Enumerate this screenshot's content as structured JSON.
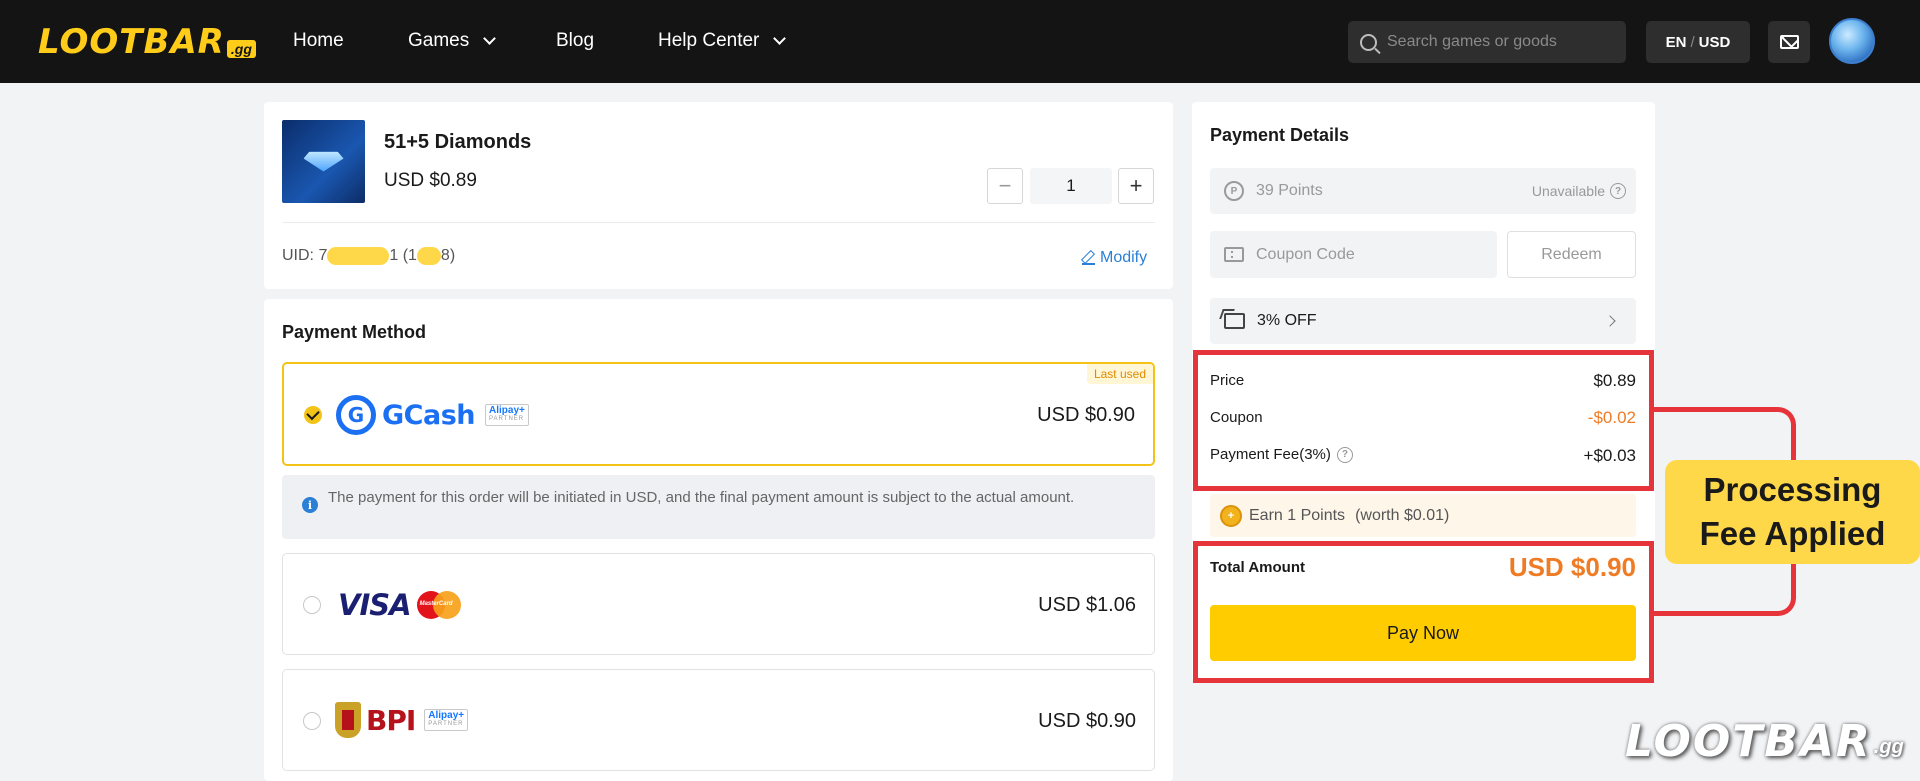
{
  "nav": {
    "logo_text": "LOOTBAR",
    "logo_suffix": ".gg",
    "home": "Home",
    "games": "Games",
    "blog": "Blog",
    "help_center": "Help Center",
    "search_placeholder": "Search games or goods",
    "lang": "EN",
    "currency": "USD"
  },
  "product": {
    "title": "51+5 Diamonds",
    "price": "USD $0.89",
    "quantity": "1",
    "uid_prefix": "UID: 7",
    "uid_mid": "1 (1",
    "uid_end": "8)",
    "modify": "Modify"
  },
  "payment_method": {
    "title": "Payment Method",
    "last_used": "Last used",
    "info": "The payment for this order will be initiated in USD, and the final payment amount is subject to the actual amount.",
    "options": [
      {
        "name": "GCash",
        "badge_top": "Alipay+",
        "badge_bottom": "PARTNER",
        "amount": "USD $0.90",
        "selected": true
      },
      {
        "name": "VISA",
        "mc_label": "MasterCard",
        "amount": "USD $1.06",
        "selected": false
      },
      {
        "name": "BPI",
        "badge_top": "Alipay+",
        "badge_bottom": "PARTNER",
        "amount": "USD $0.90",
        "selected": false
      }
    ]
  },
  "payment_details": {
    "title": "Payment Details",
    "points": "39 Points",
    "points_status": "Unavailable",
    "coupon_placeholder": "Coupon Code",
    "redeem": "Redeem",
    "discount": "3% OFF",
    "price_label": "Price",
    "price_value": "$0.89",
    "coupon_label": "Coupon",
    "coupon_value": "-$0.02",
    "fee_label": "Payment Fee(3%)",
    "fee_value": "+$0.03",
    "earn_text": "Earn 1 Points",
    "earn_worth": "(worth $0.01)",
    "total_label": "Total Amount",
    "total_value": "USD $0.90",
    "pay_now": "Pay Now"
  },
  "annotation": {
    "label": "Processing Fee Applied",
    "color": "#e5343a",
    "label_bg": "#ffd84a"
  },
  "watermark": {
    "text": "LOOTBAR",
    "suffix": ".gg"
  },
  "colors": {
    "accent": "#ffcc00",
    "orange": "#f07b25",
    "link": "#2b7fd6"
  }
}
